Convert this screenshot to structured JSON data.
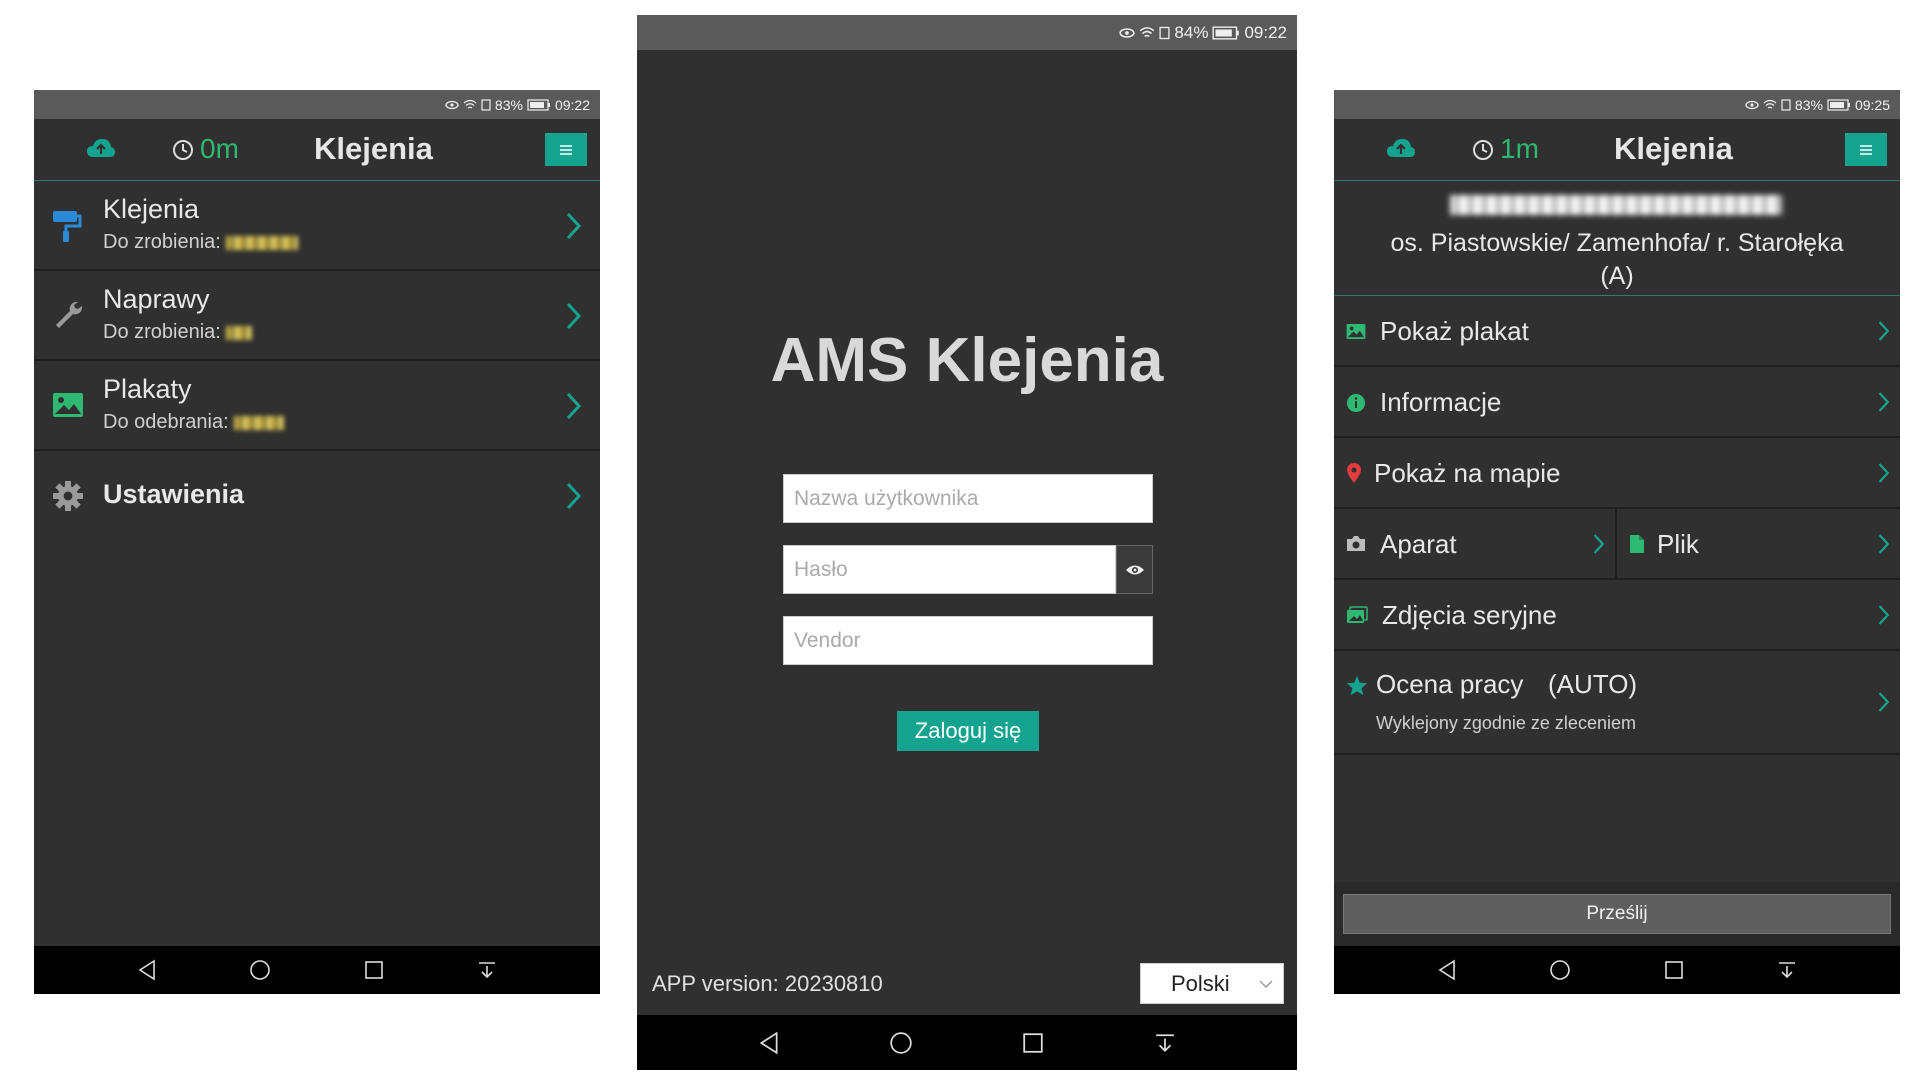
{
  "colors": {
    "accent": "#13a38e",
    "green": "#2eb872",
    "blue_icon": "#2a8ad8",
    "red_pin": "#e23b3b",
    "bg": "#303030"
  },
  "left": {
    "status": {
      "battery": "83%",
      "time": "09:22"
    },
    "appbar": {
      "timer": "0m",
      "title": "Klejenia"
    },
    "menu": [
      {
        "label": "Klejenia",
        "sub": "Do zrobienia:",
        "icon": "paint-roller-icon"
      },
      {
        "label": "Naprawy",
        "sub": "Do zrobienia:",
        "icon": "wrench-icon"
      },
      {
        "label": "Plakaty",
        "sub": "Do odebrania:",
        "icon": "image-icon"
      },
      {
        "label": "Ustawienia",
        "sub": "",
        "icon": "gear-icon"
      }
    ]
  },
  "middle": {
    "status": {
      "battery": "84%",
      "time": "09:22"
    },
    "title": "AMS Klejenia",
    "username_placeholder": "Nazwa użytkownika",
    "password_placeholder": "Hasło",
    "vendor_placeholder": "Vendor",
    "login_label": "Zaloguj się",
    "version": "APP version: 20230810",
    "language": "Polski"
  },
  "right": {
    "status": {
      "battery": "83%",
      "time": "09:25"
    },
    "appbar": {
      "timer": "1m",
      "title": "Klejenia"
    },
    "header_line2": "os. Piastowskie/ Zamenhofa/ r. Starołęka",
    "header_line3": "(A)",
    "rows": {
      "poster": "Pokaż plakat",
      "info": "Informacje",
      "map": "Pokaż na mapie",
      "camera": "Aparat",
      "file": "Plik",
      "serial": "Zdjęcia seryjne",
      "rating": "Ocena pracy",
      "rating_mode": "(AUTO)",
      "rating_sub": "Wyklejony zgodnie ze zleceniem"
    },
    "submit_label": "Prześlij"
  }
}
